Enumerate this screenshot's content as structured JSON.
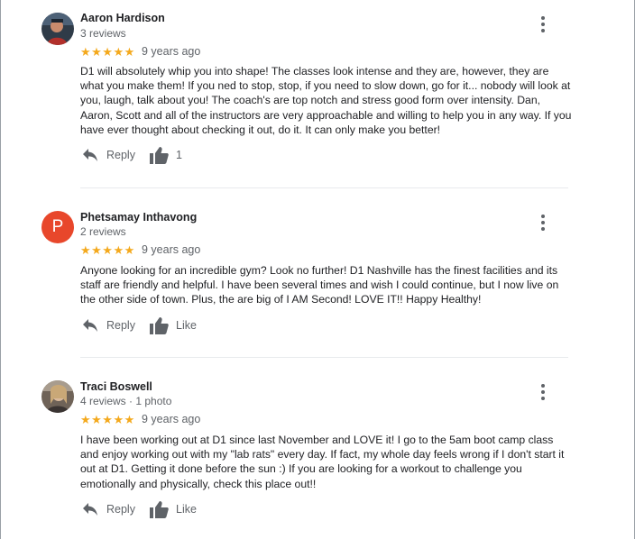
{
  "labels": {
    "reply": "Reply",
    "like": "Like"
  },
  "reviews": [
    {
      "name": "Aaron Hardison",
      "meta": "3 reviews",
      "stars": "★★★★★",
      "rating": 5,
      "age": "9 years ago",
      "text": "D1 will absolutely whip you into shape! The classes look intense and they are, however, they are what you make them! If you ned to stop, stop, if you need to slow down, go for it... nobody will look at you, laugh, talk about you! The coach's are top notch and stress good form over intensity.  Dan, Aaron, Scott and all of the instructors are very approachable and willing to help you in any way.  If you have ever thought about checking it out, do it. It can only make you better!",
      "like_label": "1",
      "avatar_color": "#3b4a5a"
    },
    {
      "name": "Phetsamay Inthavong",
      "meta": "2 reviews",
      "stars": "★★★★★",
      "rating": 5,
      "age": "9 years ago",
      "text": "Anyone looking for an incredible gym? Look no further! D1 Nashville has the finest facilities and its staff are friendly and helpful. I have been several times and wish I could continue, but I now live on the other side of town. Plus, the are big of I AM Second! LOVE IT!! Happy Healthy!",
      "like_label": "Like",
      "avatar_letter": "P",
      "avatar_color": "#e8472b"
    },
    {
      "name": "Traci Boswell",
      "meta": "4 reviews · 1 photo",
      "stars": "★★★★★",
      "rating": 5,
      "age": "9 years ago",
      "text": "I have been working out at D1 since last November and LOVE it! I go to the 5am boot camp class and enjoy working out with my \"lab rats\" every day. If fact, my whole day feels wrong if I don't start it out at D1. Getting it done before the sun :) If you are looking for a workout to challenge you emotionally and physically, check this place out!!",
      "like_label": "Like",
      "avatar_color": "#8a7a6a"
    }
  ]
}
